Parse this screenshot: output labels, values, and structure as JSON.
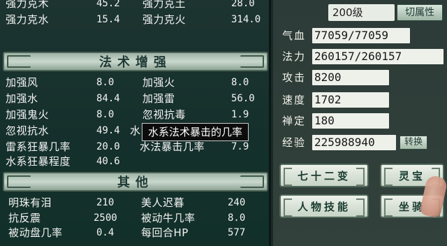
{
  "top_rows": [
    {
      "l1": "强力克木",
      "v1": "45.2",
      "l2": "强力克土",
      "v2": "28.0"
    },
    {
      "l1": "强力克水",
      "v1": "15.4",
      "l2": "强力克火",
      "v2": "314.0"
    }
  ],
  "magic": {
    "title": "法术增强",
    "rows": [
      {
        "l1": "加强风",
        "v1": "8.0",
        "l2": "加强火",
        "v2": "8.0"
      },
      {
        "l1": "加强水",
        "v1": "84.4",
        "l2": "加强雷",
        "v2": "56.0"
      },
      {
        "l1": "加强鬼火",
        "v1": "8.0",
        "l2": "忽视抗毒",
        "v2": "1.9"
      },
      {
        "l1": "忽视抗水",
        "v1": "49.4",
        "l2": "水",
        "v2": ""
      },
      {
        "l1": "雷系狂暴几率",
        "v1": "20.0",
        "l2": "水法暴击几率",
        "v2": "7.9"
      },
      {
        "l1": "水系狂暴程度",
        "v1": "40.6",
        "l2": "",
        "v2": ""
      }
    ]
  },
  "tooltip": "水系法术暴击的几率",
  "other": {
    "title": "其他",
    "rows": [
      {
        "l1": "明珠有泪",
        "v1": "210",
        "l2": "美人迟暮",
        "v2": "240"
      },
      {
        "l1": "抗反震",
        "v1": "2500",
        "l2": "被动牛几率",
        "v2": "8.0"
      },
      {
        "l1": "被动盘几率",
        "v1": "0.4",
        "l2": "每回合HP",
        "v2": "577"
      }
    ]
  },
  "header": {
    "level": "200级",
    "switch_label": "切属性"
  },
  "attributes": [
    {
      "label": "气血",
      "value": "77059/77059"
    },
    {
      "label": "法力",
      "value": "260157/260157"
    },
    {
      "label": "攻击",
      "value": "8200"
    },
    {
      "label": "速度",
      "value": "1702"
    },
    {
      "label": "禅定",
      "value": "180"
    },
    {
      "label": "经验",
      "value": "225988940"
    }
  ],
  "exchange_label": "转换",
  "buttons": {
    "seventy_two": "七十二变",
    "spirit": "灵宝",
    "journey": "人物技能",
    "mount": "坐骑"
  },
  "colors": {
    "panel": "#15302c",
    "header": "#c9d8cd",
    "value_box": "#eef1ea"
  }
}
